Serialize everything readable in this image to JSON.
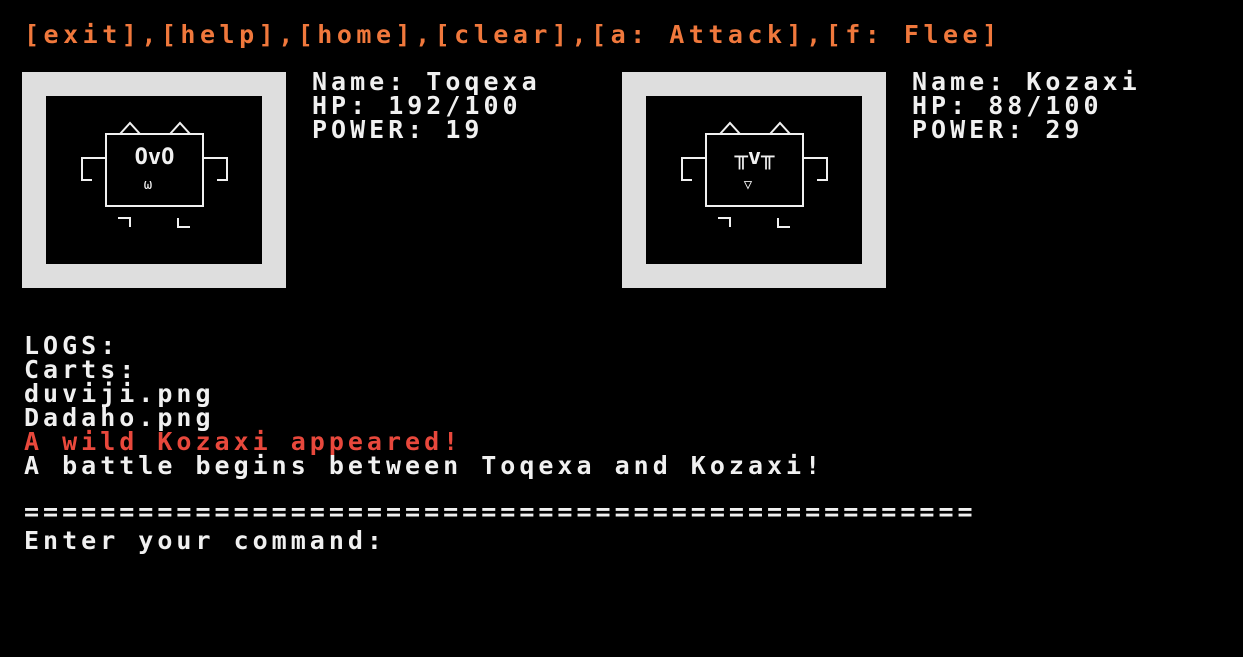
{
  "menu": {
    "items": [
      {
        "label": "[exit]"
      },
      {
        "label": "[help]"
      },
      {
        "label": "[home]"
      },
      {
        "label": "[clear]"
      },
      {
        "label": "[a: Attack]"
      },
      {
        "label": "[f: Flee]"
      }
    ],
    "separator": ","
  },
  "player": {
    "name_line": "Name: Toqexa",
    "hp_line": "HP: 192/100",
    "power_line": "POWER: 19",
    "face": {
      "eyes": "OvO",
      "mouth": "ω"
    }
  },
  "enemy": {
    "name_line": "Name: Kozaxi",
    "hp_line": "HP: 88/100",
    "power_line": "POWER: 29",
    "face": {
      "eyes": "╥v╥",
      "mouth": "▽"
    }
  },
  "logs": {
    "header": "LOGS:",
    "lines": [
      {
        "text": "Carts:",
        "type": "normal"
      },
      {
        "text": "duviji.png",
        "type": "normal"
      },
      {
        "text": "Dadaho.png",
        "type": "normal"
      },
      {
        "text": "A wild Kozaxi appeared!",
        "type": "alert"
      },
      {
        "text": "A battle begins between Toqexa and Kozaxi!",
        "type": "normal"
      }
    ]
  },
  "divider": "==================================================",
  "prompt": {
    "label": "Enter your command:",
    "value": ""
  },
  "colors": {
    "menu": "#f0783c",
    "alert": "#e8483c",
    "text": "#f0f0f0",
    "frame": "#dedede",
    "background": "#000000"
  }
}
